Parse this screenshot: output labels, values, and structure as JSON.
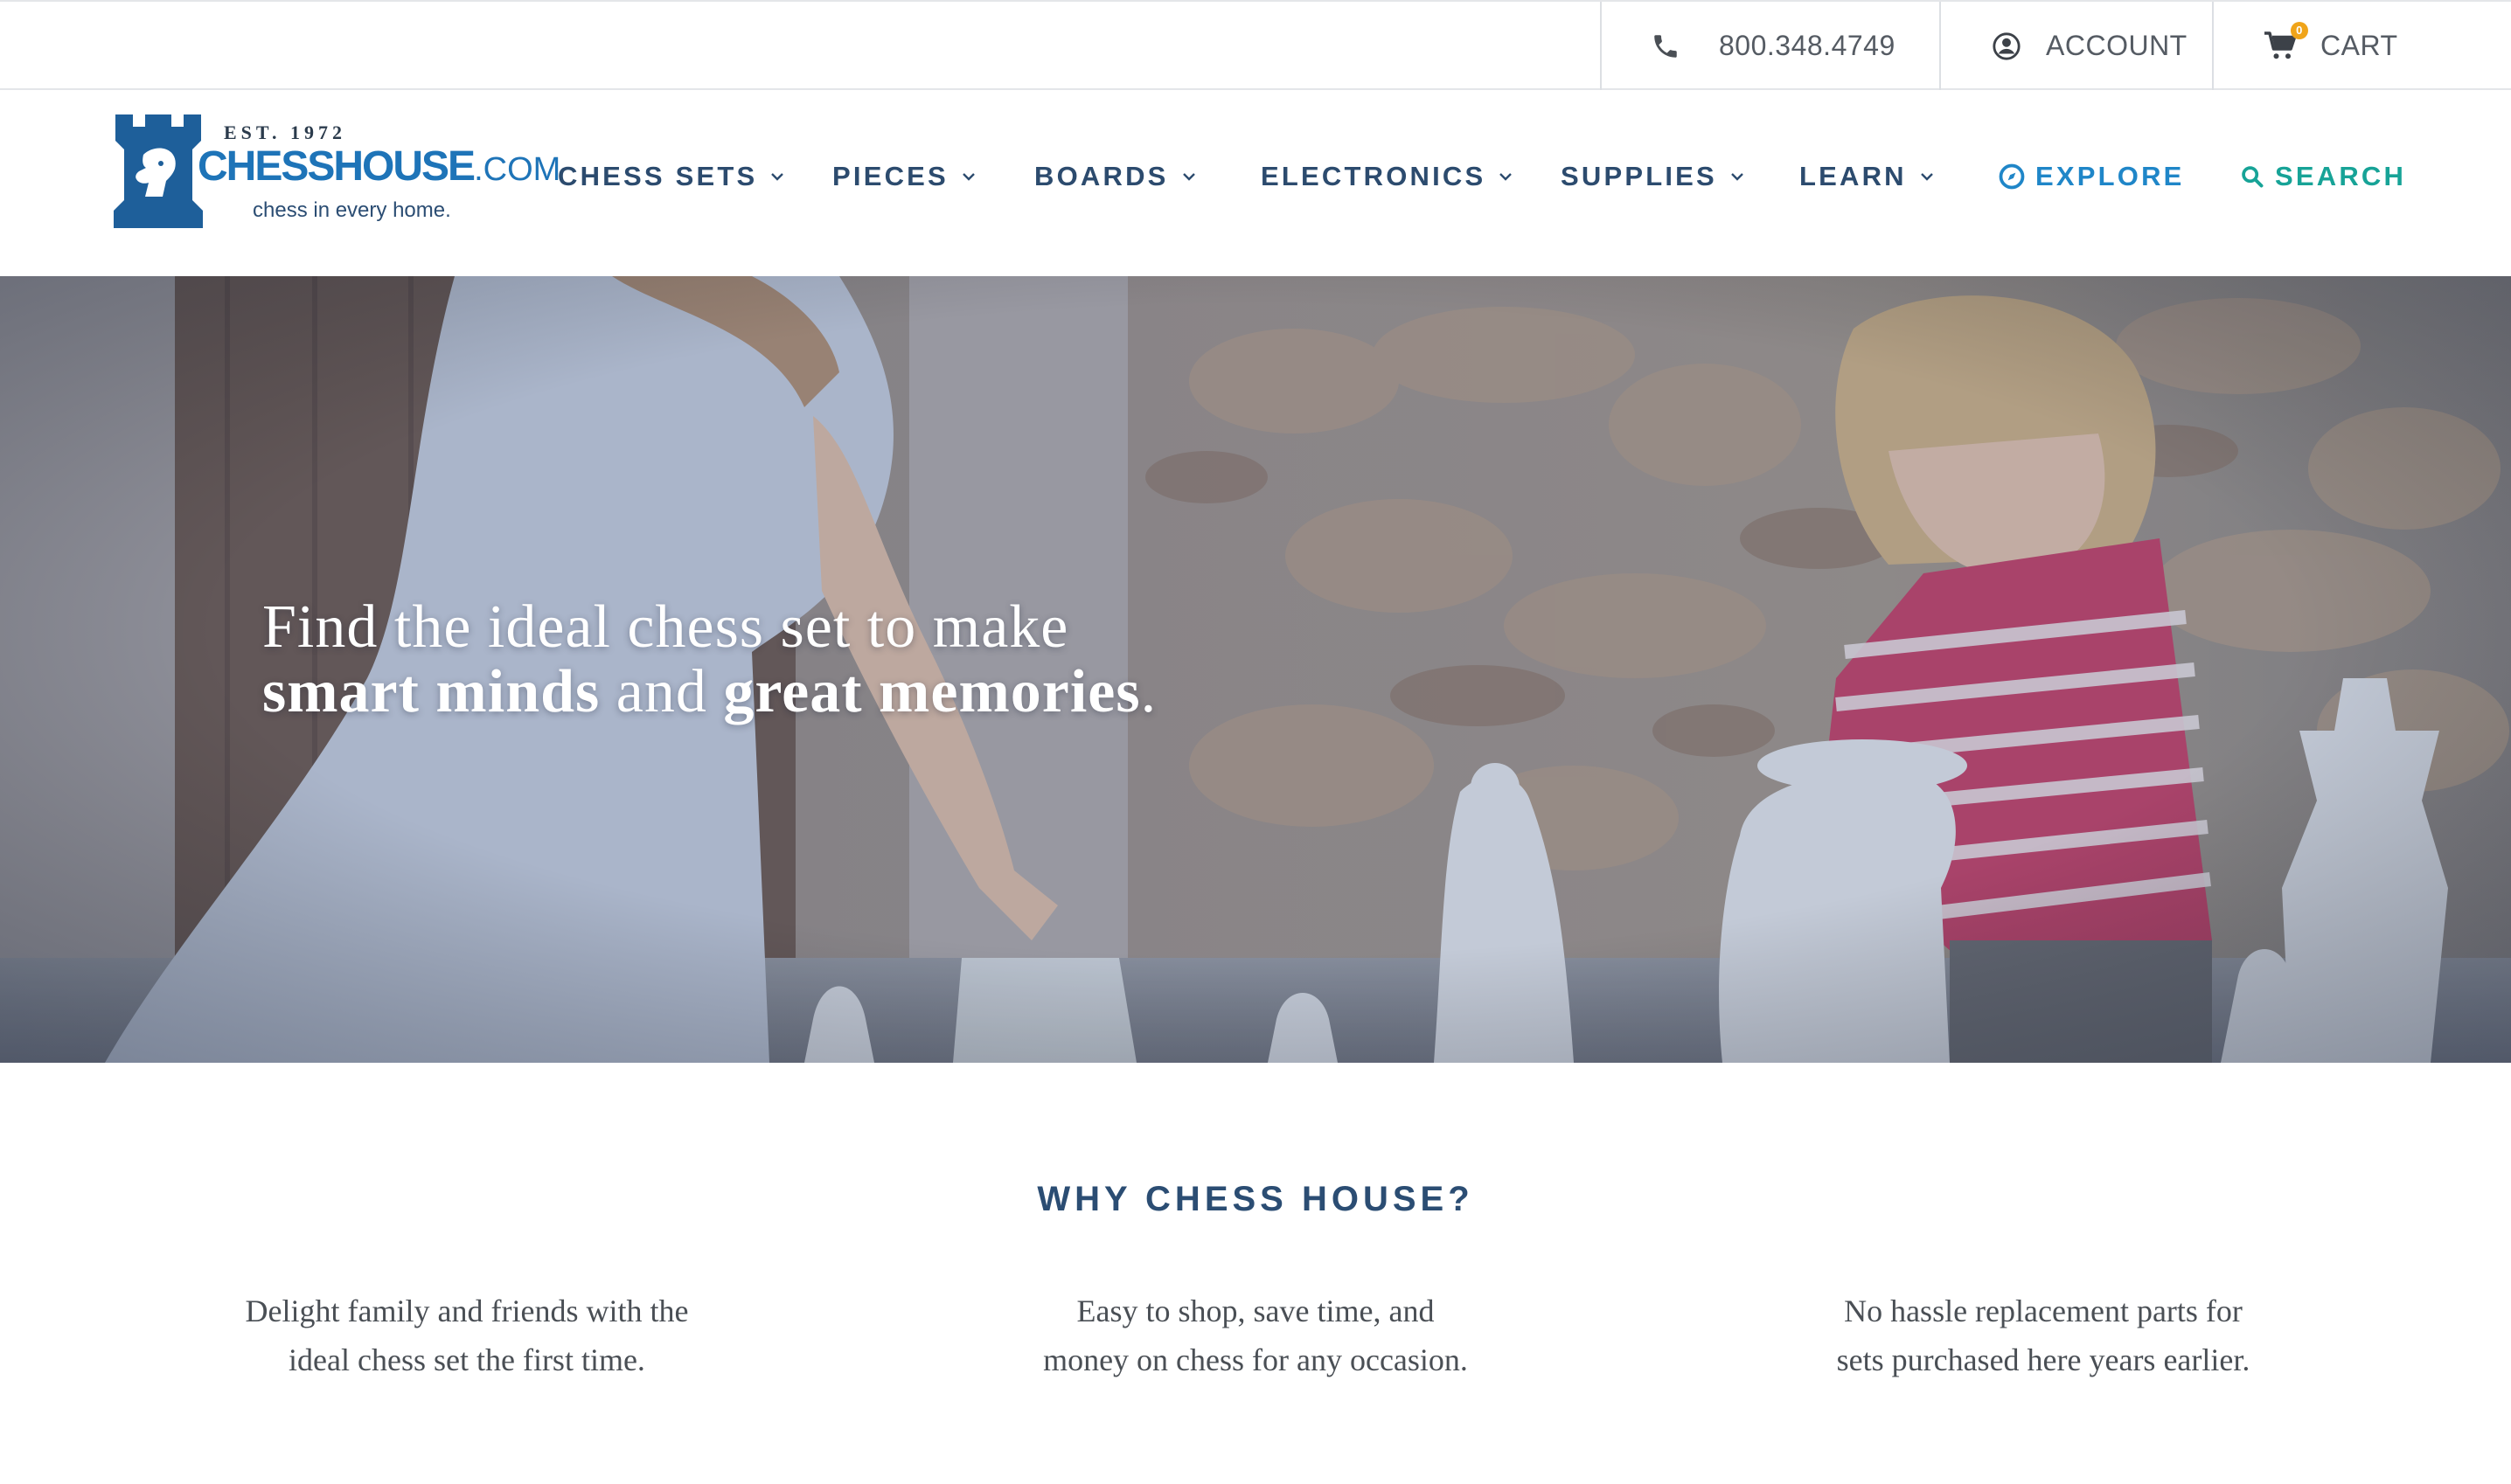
{
  "topbar": {
    "phone": "800.348.4749",
    "account_label": "ACCOUNT",
    "cart_label": "CART",
    "cart_count": "0"
  },
  "logo": {
    "est": "EST. 1972",
    "name_main": "CHESSHOUSE",
    "name_domain": ".COM",
    "tagline": "chess in every home."
  },
  "nav": {
    "items": [
      {
        "label": "CHESS SETS"
      },
      {
        "label": "PIECES"
      },
      {
        "label": "BOARDS"
      },
      {
        "label": "ELECTRONICS"
      },
      {
        "label": "SUPPLIES"
      },
      {
        "label": "LEARN"
      }
    ],
    "explore_label": "EXPLORE",
    "search_label": "SEARCH"
  },
  "hero": {
    "line1": "Find the ideal chess set to make",
    "bold1": "smart minds",
    "mid": " and ",
    "bold2": "great memories",
    "end": "."
  },
  "why": {
    "title": "WHY CHESS HOUSE?",
    "features": [
      {
        "line1": "Delight family and friends with the",
        "line2": "ideal chess set the first time."
      },
      {
        "line1": "Easy to shop, save time, and",
        "line2": "money on chess for any occasion."
      },
      {
        "line1": "No hassle replacement parts for",
        "line2": "sets purchased here years earlier."
      }
    ]
  },
  "colors": {
    "nav_text": "#2c4b6e",
    "brand_blue": "#1e74b8",
    "explore": "#1f86c8",
    "search": "#17a397",
    "cart_badge": "#f0a419"
  },
  "icons": {
    "phone": "phone-icon",
    "account": "user-icon",
    "cart": "cart-icon",
    "explore": "compass-icon",
    "search": "search-icon"
  }
}
